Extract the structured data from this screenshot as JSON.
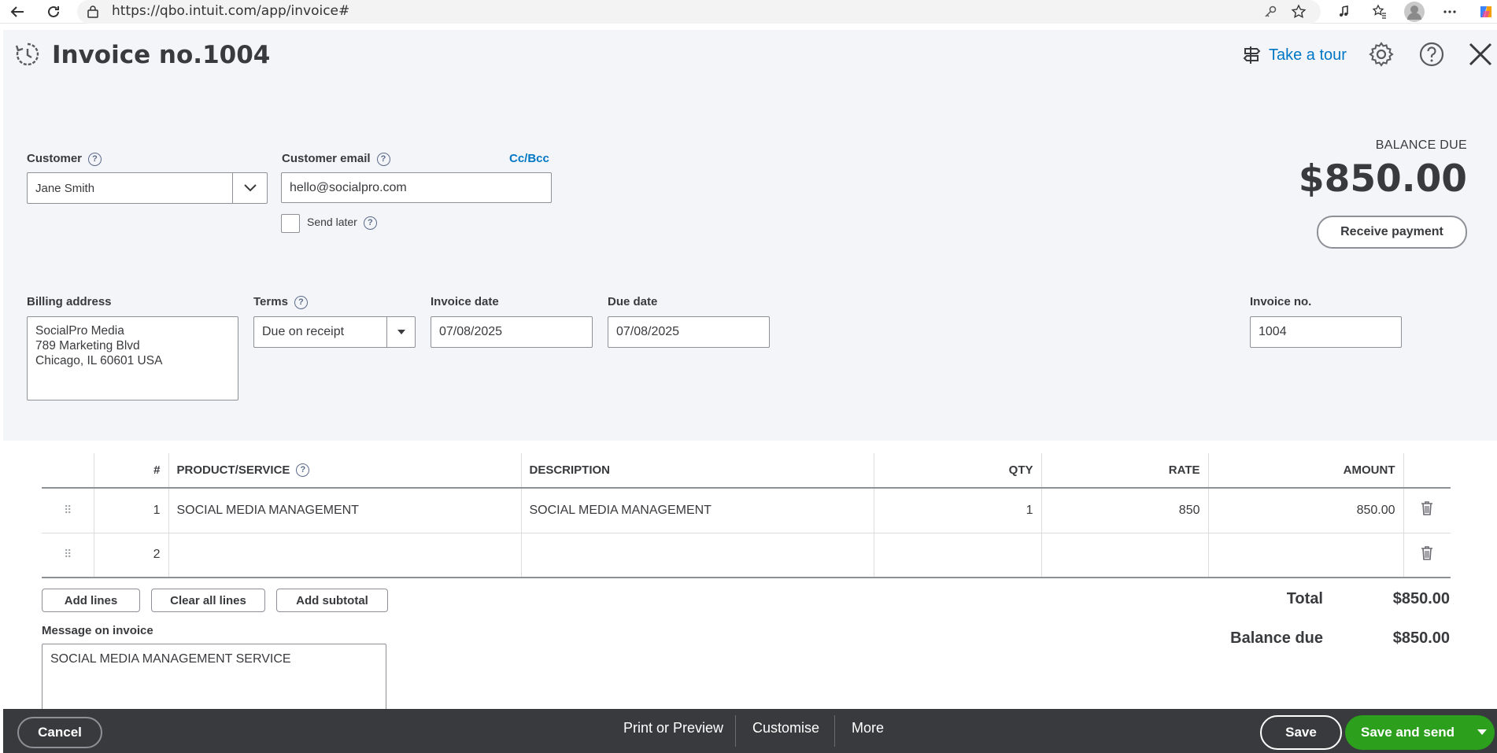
{
  "browser": {
    "url": "https://qbo.intuit.com/app/invoice#"
  },
  "header": {
    "title": "Invoice no.1004",
    "take_tour": "Take a tour"
  },
  "customer": {
    "label": "Customer",
    "value": "Jane Smith"
  },
  "email": {
    "label": "Customer email",
    "value": "hello@socialpro.com",
    "ccbcc": "Cc/Bcc",
    "send_later": "Send later"
  },
  "balance": {
    "label": "BALANCE DUE",
    "amount": "$850.00",
    "receive_payment": "Receive payment"
  },
  "billing": {
    "label": "Billing address",
    "line1": "SocialPro Media",
    "line2": "789 Marketing Blvd",
    "line3": "Chicago, IL  60601 USA"
  },
  "terms": {
    "label": "Terms",
    "value": "Due on receipt"
  },
  "invoice_date": {
    "label": "Invoice date",
    "value": "07/08/2025"
  },
  "due_date": {
    "label": "Due date",
    "value": "07/08/2025"
  },
  "invoice_no": {
    "label": "Invoice no.",
    "value": "1004"
  },
  "table": {
    "headers": [
      "#",
      "PRODUCT/SERVICE",
      "DESCRIPTION",
      "QTY",
      "RATE",
      "AMOUNT"
    ],
    "rows": [
      {
        "num": "1",
        "product": "SOCIAL MEDIA MANAGEMENT",
        "description": "SOCIAL MEDIA MANAGEMENT",
        "qty": "1",
        "rate": "850",
        "amount": "850.00"
      },
      {
        "num": "2",
        "product": "",
        "description": "",
        "qty": "",
        "rate": "",
        "amount": ""
      }
    ]
  },
  "line_buttons": {
    "add_lines": "Add lines",
    "clear_all": "Clear all lines",
    "add_subtotal": "Add subtotal"
  },
  "totals": {
    "total_label": "Total",
    "total_value": "$850.00",
    "balance_label": "Balance due",
    "balance_value": "$850.00"
  },
  "message": {
    "label": "Message on invoice",
    "value": "SOCIAL MEDIA MANAGEMENT SERVICE"
  },
  "footer": {
    "cancel": "Cancel",
    "print": "Print or Preview",
    "customise": "Customise",
    "more": "More",
    "save": "Save",
    "save_send": "Save and send"
  },
  "colors": {
    "link": "#0077c5",
    "primary_green": "#2ca01c",
    "footer_bg": "#393a3d",
    "page_bg": "#f4f5f8"
  }
}
